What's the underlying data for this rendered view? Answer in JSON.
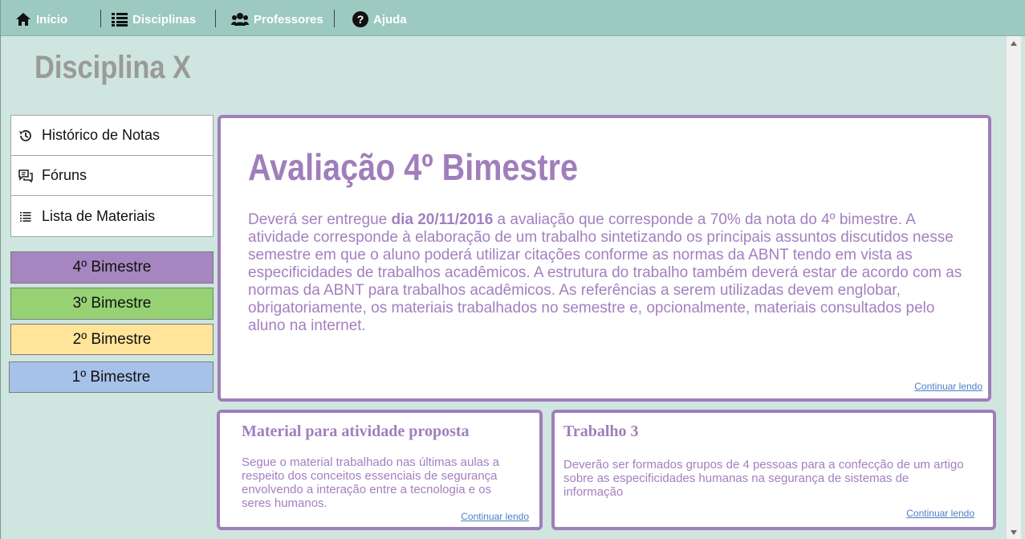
{
  "nav": {
    "items": [
      {
        "label": "Início",
        "icon": "home-icon"
      },
      {
        "label": "Disciplinas",
        "icon": "list-icon"
      },
      {
        "label": "Professores",
        "icon": "users-icon"
      },
      {
        "label": "Ajuda",
        "icon": "question-icon"
      }
    ]
  },
  "page": {
    "title": "Disciplina X"
  },
  "menu": {
    "items": [
      {
        "label": "Histórico de Notas",
        "icon": "history-icon"
      },
      {
        "label": "Fóruns",
        "icon": "forum-icon"
      },
      {
        "label": "Lista de Materiais",
        "icon": "list-icon"
      }
    ]
  },
  "bimestres": [
    {
      "label": "4º Bimestre",
      "color": "#a586c0"
    },
    {
      "label": "3º Bimestre",
      "color": "#96d273"
    },
    {
      "label": "2º Bimestre",
      "color": "#ffe49a"
    },
    {
      "label": "1º Bimestre",
      "color": "#a7c2ea"
    }
  ],
  "main_card": {
    "title": "Avaliação 4º Bimestre",
    "text_before": "Deverá ser entregue ",
    "text_bold": "dia 20/11/2016",
    "text_after": " a avaliação que corresponde a 70% da nota do 4º bimestre. A atividade corresponde à elaboração de um trabalho sintetizando os principais assuntos discutidos nesse semestre em que o aluno poderá utilizar citações conforme as normas da ABNT tendo em vista as especificidades de trabalhos acadêmicos. A estrutura do trabalho também deverá estar de acordo com as normas da ABNT para trabalhos acadêmicos. As referências a serem utilizadas devem englobar, obrigatoriamente, os materiais trabalhados no semestre e, opcionalmente, materiais consultados pelo aluno na internet.",
    "more": "Continuar lendo"
  },
  "card_left": {
    "title": "Material  para atividade proposta",
    "text": "Segue o material trabalhado nas últimas aulas a respeito dos conceitos essenciais de segurança envolvendo a interação entre a tecnologia e os seres humanos.",
    "more": "Continuar lendo"
  },
  "card_right": {
    "title": "Trabalho 3",
    "text": "Deverão ser formados grupos de 4 pessoas para a confecção de um artigo sobre as especificidades humanas na segurança de sistemas de informação",
    "more": "Continuar lendo"
  },
  "colors": {
    "accent": "#a07ebb",
    "nav_bg": "#9cc9c0",
    "page_bg": "#cfe5df"
  }
}
